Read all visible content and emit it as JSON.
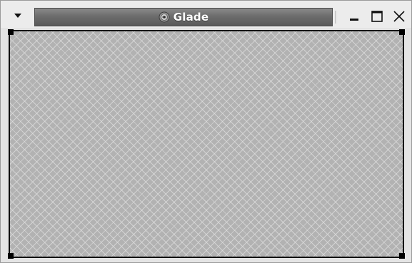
{
  "window": {
    "title": "Glade",
    "app_icon": "glade-logo-icon",
    "buttons": {
      "menu_icon": "triangle-down-icon",
      "minimize_icon": "minimize-icon",
      "maximize_icon": "maximize-icon",
      "close_icon": "close-icon"
    }
  },
  "canvas": {
    "pattern": "crosshatch",
    "background_color": "#b2b2b2",
    "selection_handles": [
      "top-left",
      "top-right",
      "bottom-left",
      "bottom-right"
    ]
  },
  "colors": {
    "titlebar_bg": "#ececec",
    "title_strip": "#6c6c6c",
    "title_text": "#ffffff",
    "selection_border": "#111111"
  }
}
